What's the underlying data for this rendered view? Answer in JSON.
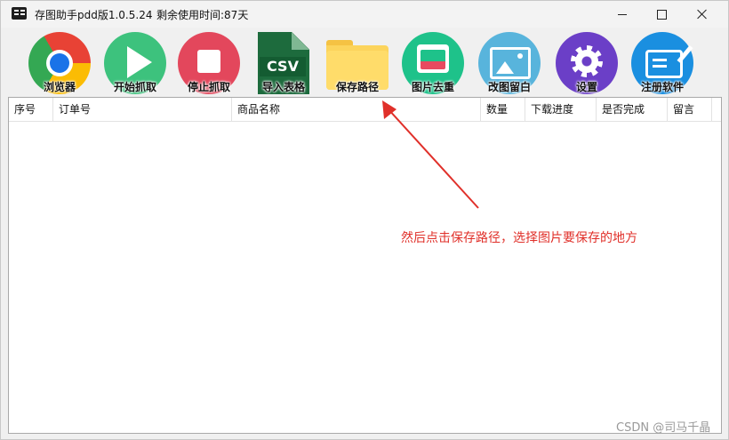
{
  "window": {
    "title": "存图助手pdd版1.0.5.24",
    "remaining": "剩余使用时间:87天"
  },
  "toolbar": {
    "items": [
      {
        "label": "浏览器",
        "icon": "chrome-icon"
      },
      {
        "label": "开始抓取",
        "icon": "play-icon"
      },
      {
        "label": "停止抓取",
        "icon": "stop-icon"
      },
      {
        "label": "导入表格",
        "icon": "csv-file-icon"
      },
      {
        "label": "保存路径",
        "icon": "folder-icon"
      },
      {
        "label": "图片去重",
        "icon": "images-icon"
      },
      {
        "label": "改图留白",
        "icon": "image-icon"
      },
      {
        "label": "设置",
        "icon": "gear-icon"
      },
      {
        "label": "注册软件",
        "icon": "register-icon"
      }
    ],
    "csv_text": "CSV"
  },
  "table": {
    "columns": [
      "序号",
      "订单号",
      "商品名称",
      "数量",
      "下载进度",
      "是否完成",
      "留言"
    ],
    "rows": []
  },
  "annotation": {
    "text": "然后点击保存路径，选择图片要保存的地方",
    "color": "#e0302a"
  },
  "watermark": "CSDN @司马千晶"
}
